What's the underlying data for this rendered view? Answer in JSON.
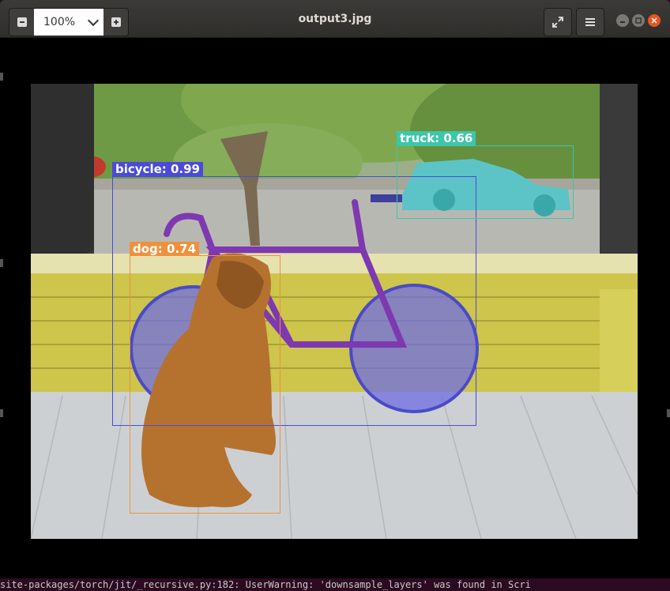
{
  "window": {
    "title": "output3.jpg"
  },
  "toolbar": {
    "zoom_value": "100%"
  },
  "detections": [
    {
      "label": "bicycle: 0.99",
      "color": "#4b4bd8"
    },
    {
      "label": "truck: 0.66",
      "color": "#3cc7a8"
    },
    {
      "label": "dog: 0.74",
      "color": "#f0903c"
    }
  ],
  "terminal": {
    "line": "site-packages/torch/jit/_recursive.py:182: UserWarning: 'downsample_layers' was found in Scri"
  },
  "colors": {
    "titlebar": "#33322f",
    "close": "#e95420",
    "bicycle": "#4b4bd8",
    "truck": "#3cc7a8",
    "dog": "#f0903c"
  },
  "icons": [
    "zoom-out-icon",
    "zoom-in-icon",
    "chevron-down-icon",
    "fullscreen-icon",
    "hamburger-menu-icon",
    "minimize-icon",
    "maximize-icon",
    "close-icon"
  ]
}
